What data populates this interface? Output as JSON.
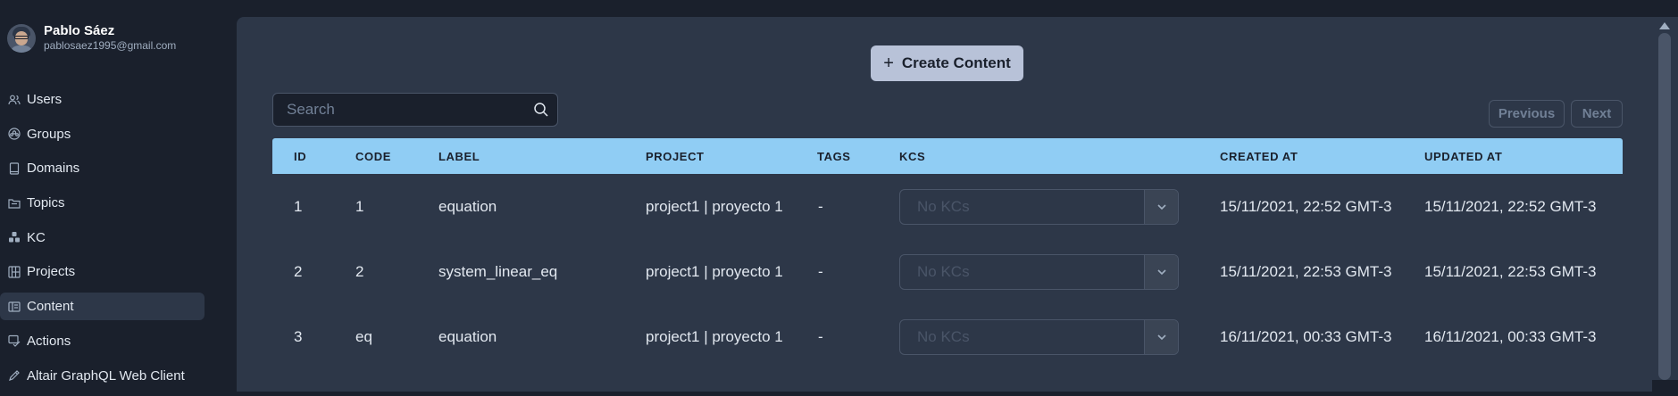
{
  "user": {
    "name": "Pablo Sáez",
    "email": "pablosaez1995@gmail.com"
  },
  "sidebar": {
    "items": [
      {
        "label": "Users",
        "icon": "users-icon"
      },
      {
        "label": "Groups",
        "icon": "groups-icon"
      },
      {
        "label": "Domains",
        "icon": "domains-icon"
      },
      {
        "label": "Topics",
        "icon": "topics-icon"
      },
      {
        "label": "KC",
        "icon": "kc-icon"
      },
      {
        "label": "Projects",
        "icon": "projects-icon"
      },
      {
        "label": "Content",
        "icon": "content-icon",
        "active": true
      },
      {
        "label": "Actions",
        "icon": "actions-icon"
      },
      {
        "label": "Altair GraphQL Web Client",
        "icon": "altair-icon"
      }
    ]
  },
  "toolbar": {
    "create_label": "Create Content",
    "search_placeholder": "Search",
    "previous_label": "Previous",
    "next_label": "Next"
  },
  "table": {
    "headers": [
      "ID",
      "CODE",
      "LABEL",
      "PROJECT",
      "TAGS",
      "KCS",
      "CREATED AT",
      "UPDATED AT"
    ],
    "kcs_placeholder": "No KCs",
    "rows": [
      {
        "id": "1",
        "code": "1",
        "label": "equation",
        "project": "project1 | proyecto 1",
        "tags": "-",
        "created_at": "15/11/2021, 22:52 GMT-3",
        "updated_at": "15/11/2021, 22:52 GMT-3"
      },
      {
        "id": "2",
        "code": "2",
        "label": "system_linear_eq",
        "project": "project1 | proyecto 1",
        "tags": "-",
        "created_at": "15/11/2021, 22:53 GMT-3",
        "updated_at": "15/11/2021, 22:53 GMT-3"
      },
      {
        "id": "3",
        "code": "eq",
        "label": "equation",
        "project": "project1 | proyecto 1",
        "tags": "-",
        "created_at": "16/11/2021, 00:33 GMT-3",
        "updated_at": "16/11/2021, 00:33 GMT-3"
      }
    ]
  },
  "colors": {
    "background": "#1a202c",
    "panel": "#2d3748",
    "table_header": "#90cdf4",
    "create_button": "#b8c2d8",
    "active_nav": "#2d3748"
  }
}
